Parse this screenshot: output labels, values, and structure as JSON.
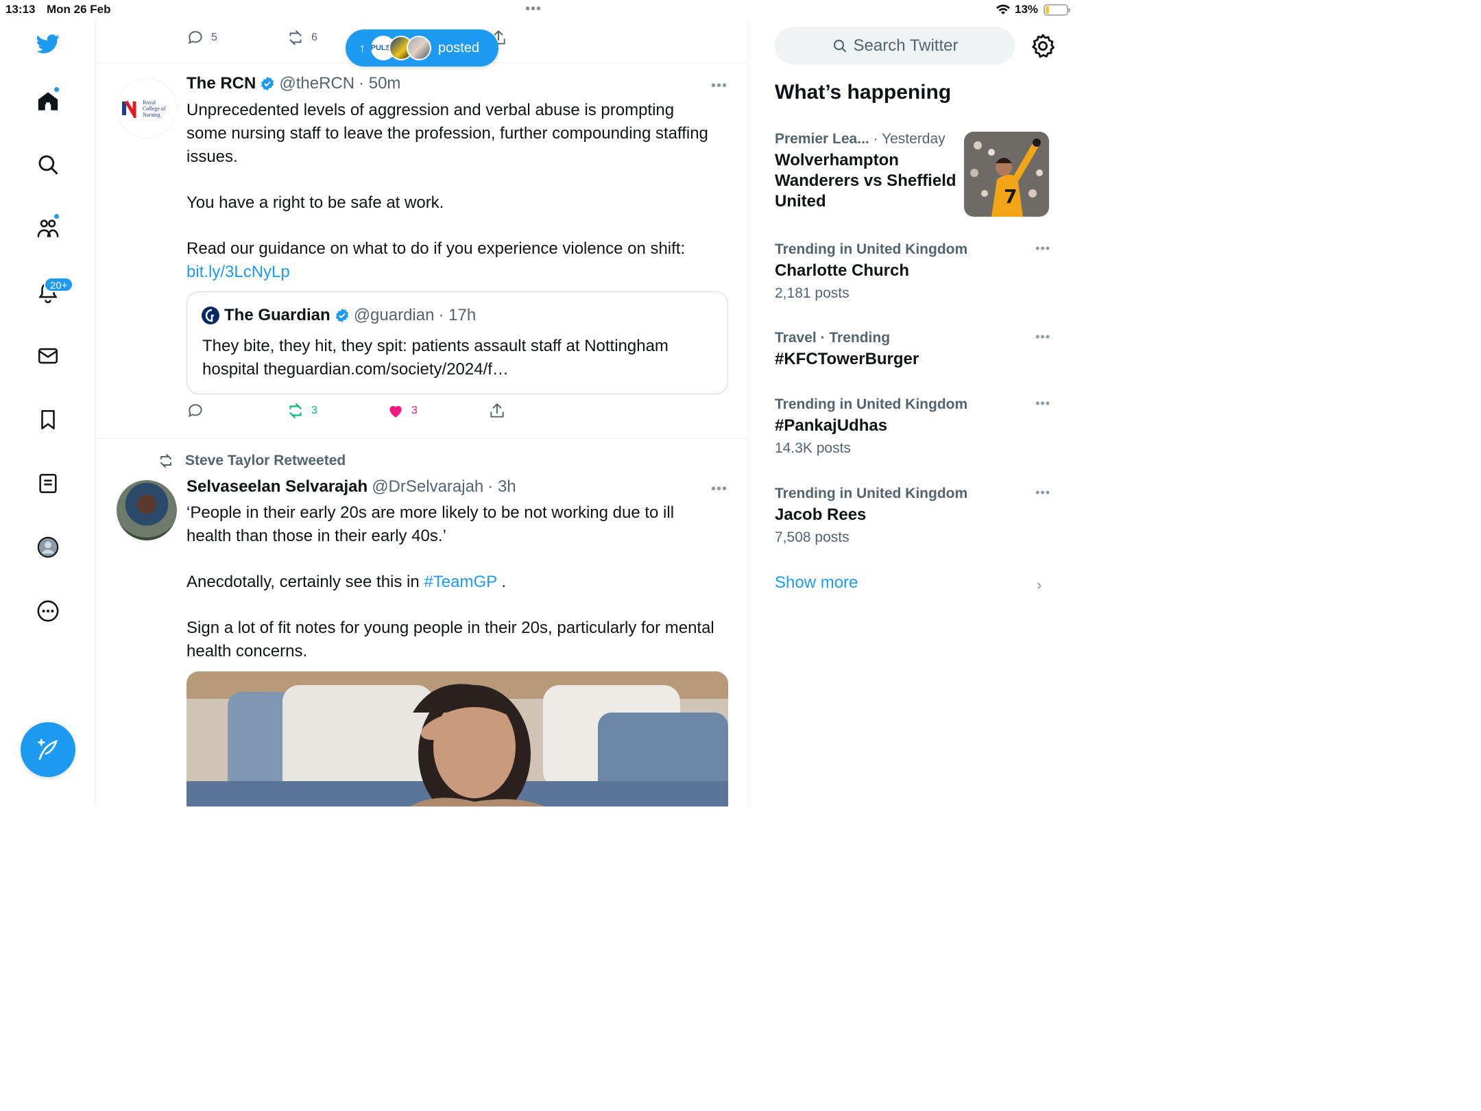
{
  "status_bar": {
    "time": "13:13",
    "date": "Mon 26 Feb",
    "battery_text": "13%",
    "battery_level": 0.13
  },
  "nav": {
    "notifications_badge": "20+",
    "accent_color": "#1d9bf0",
    "icons": [
      "twitter-logo-icon",
      "home-icon",
      "search-icon",
      "communities-icon",
      "notifications-icon",
      "messages-icon",
      "bookmarks-icon",
      "lists-icon",
      "profile-icon",
      "more-icon",
      "compose-icon"
    ]
  },
  "top_actions": {
    "reply_count": "5",
    "retweet_count": "6"
  },
  "new_posts_pill": {
    "avatar_label": "PULSE",
    "label": "posted"
  },
  "tweets": [
    {
      "name": "The RCN",
      "handle": "@theRCN",
      "time": "· 50m",
      "avatar_text": "Royal College of Nursing",
      "paragraphs": [
        "Unprecedented levels of aggression and verbal abuse is prompting some nursing staff to leave the profession, further compounding staffing issues.",
        "You have a right to be safe at work.",
        "Read our guidance on what to do if you experience violence on shift:"
      ],
      "link": "bit.ly/3LcNyLp",
      "quote": {
        "name": "The Guardian",
        "handle": "@guardian",
        "time": "· 17h",
        "text": "They bite, they hit, they spit: patients assault staff at Nottingham hospital theguardian.com/society/2024/f…"
      },
      "retweets": "3",
      "likes": "3"
    },
    {
      "retweeted_by": "Steve Taylor Retweeted",
      "name": "Selvaseelan Selvarajah",
      "handle": "@DrSelvarajah",
      "time": "· 3h",
      "paragraph1": "‘People in their early 20s are more likely to be not working due to ill health than those in their early 40s.’",
      "paragraph2_prefix": "Anecdotally, certainly see this in",
      "hashtag": "#TeamGP",
      "paragraph2_suffix": ".",
      "paragraph3": "Sign a lot of fit notes for young people in their 20s, particularly for mental health concerns."
    }
  ],
  "sidebar": {
    "search_placeholder": "Search Twitter",
    "section_title": "What’s happening",
    "trends": [
      {
        "category": "Premier Lea...",
        "meta": "· Yesterday",
        "title": "Wolverhampton Wanderers vs Sheffield United"
      },
      {
        "category": "Trending in United Kingdom",
        "title": "Charlotte Church",
        "count": "2,181 posts"
      },
      {
        "category": "Travel · Trending",
        "title": "#KFCTowerBurger"
      },
      {
        "category": "Trending in United Kingdom",
        "title": "#PankajUdhas",
        "count": "14.3K posts"
      },
      {
        "category": "Trending in United Kingdom",
        "title": "Jacob Rees",
        "count": "7,508 posts"
      }
    ],
    "show_more": "Show more"
  }
}
